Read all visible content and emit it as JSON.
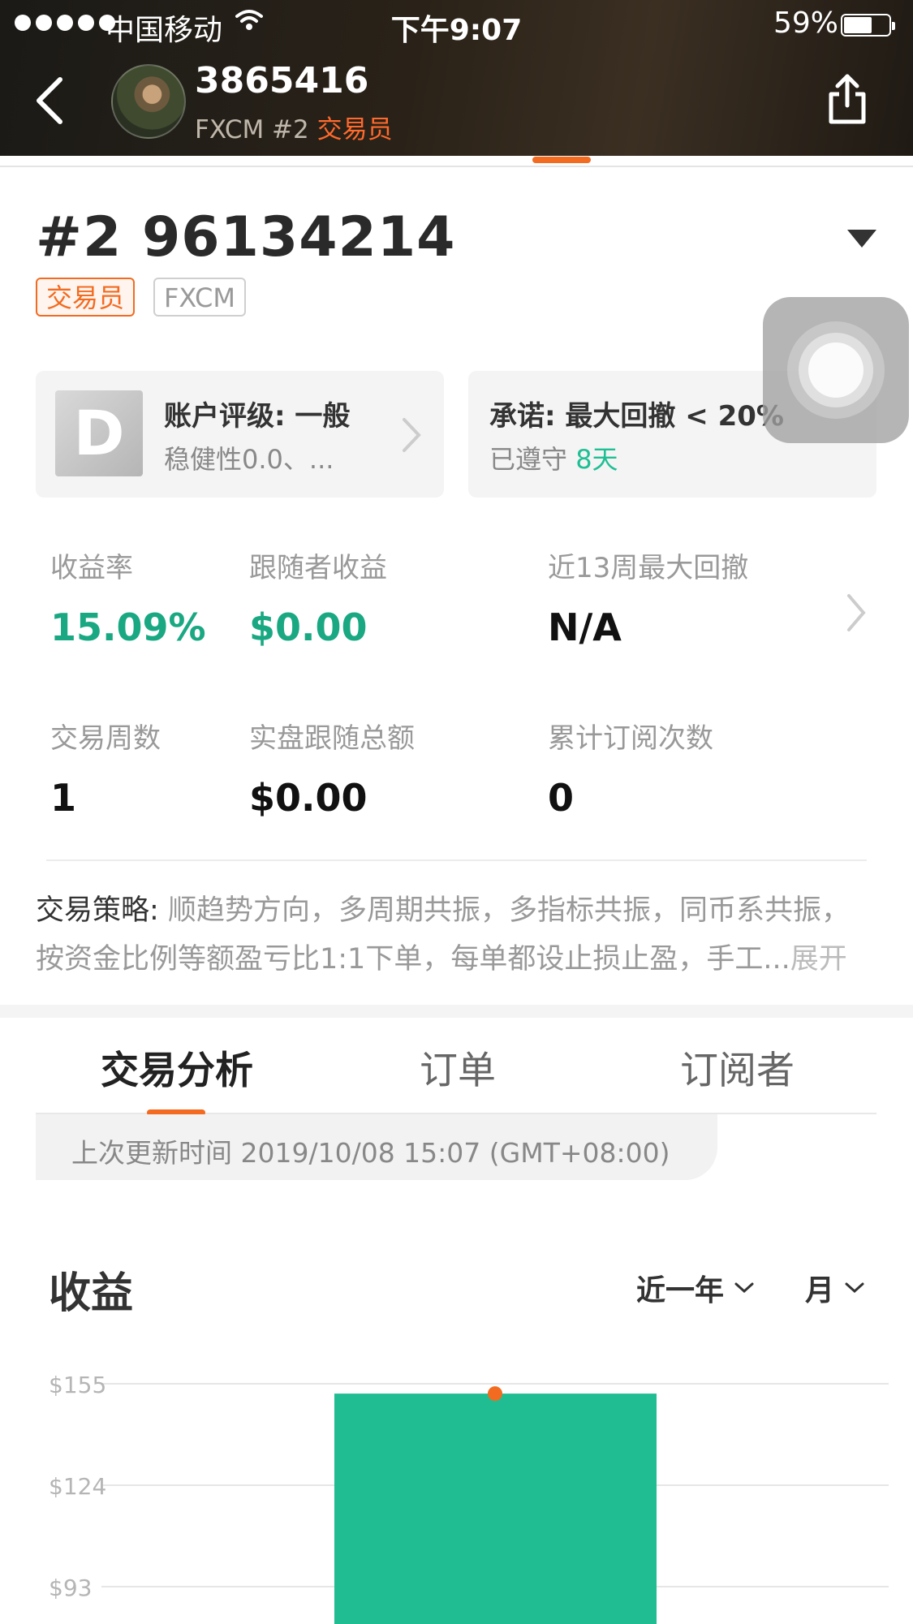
{
  "status_bar": {
    "carrier": "中国移动",
    "time": "下午9:07",
    "battery_percent": "59%",
    "battery_level": 0.59,
    "signal_bars": 5
  },
  "header": {
    "username": "3865416",
    "broker_account": "FXCM #2",
    "role": "交易员"
  },
  "account": {
    "title": "#2 96134214",
    "tags": [
      "交易员",
      "FXCM"
    ]
  },
  "cards": {
    "rating": {
      "grade": "D",
      "title": "账户评级: 一般",
      "subtitle": "稳健性0.0、..."
    },
    "promise": {
      "title": "承诺: 最大回撤 < 20%",
      "subtitle_prefix": "已遵守",
      "days": "8天"
    }
  },
  "stats": [
    {
      "label": "收益率",
      "value": "15.09%",
      "highlight": true
    },
    {
      "label": "跟随者收益",
      "value": "$0.00",
      "highlight": true
    },
    {
      "label": "近13周最大回撤",
      "value": "N/A",
      "highlight": false
    },
    {
      "label": "交易周数",
      "value": "1",
      "highlight": false
    },
    {
      "label": "实盘跟随总额",
      "value": "$0.00",
      "highlight": false
    },
    {
      "label": "累计订阅次数",
      "value": "0",
      "highlight": false
    }
  ],
  "strategy": {
    "label": "交易策略:",
    "line1": "顺趋势方向，多周期共振，多指标共振，同币系共振，",
    "line2": "按资金比例等额盈亏比1:1下单，每单都设止损止盈，手工...",
    "expand": "展开"
  },
  "tabs": [
    "交易分析",
    "订单",
    "订阅者"
  ],
  "active_tab": "交易分析",
  "update_text": "上次更新时间 2019/10/08 15:07 (GMT+08:00)",
  "earnings": {
    "title": "收益",
    "period_filter": "近一年",
    "interval_filter": "月"
  },
  "colors": {
    "accent": "#f26b20",
    "positive": "#1aa882",
    "bar": "#20bd93"
  },
  "chart_data": {
    "type": "bar",
    "categories": [
      ""
    ],
    "values": [
      152
    ],
    "ytick_labels": [
      "$155",
      "$124",
      "$93"
    ],
    "ytick_values": [
      155,
      124,
      93
    ],
    "ylim": [
      93,
      155
    ],
    "marker": "orange dot at top of bar",
    "grid": true
  }
}
